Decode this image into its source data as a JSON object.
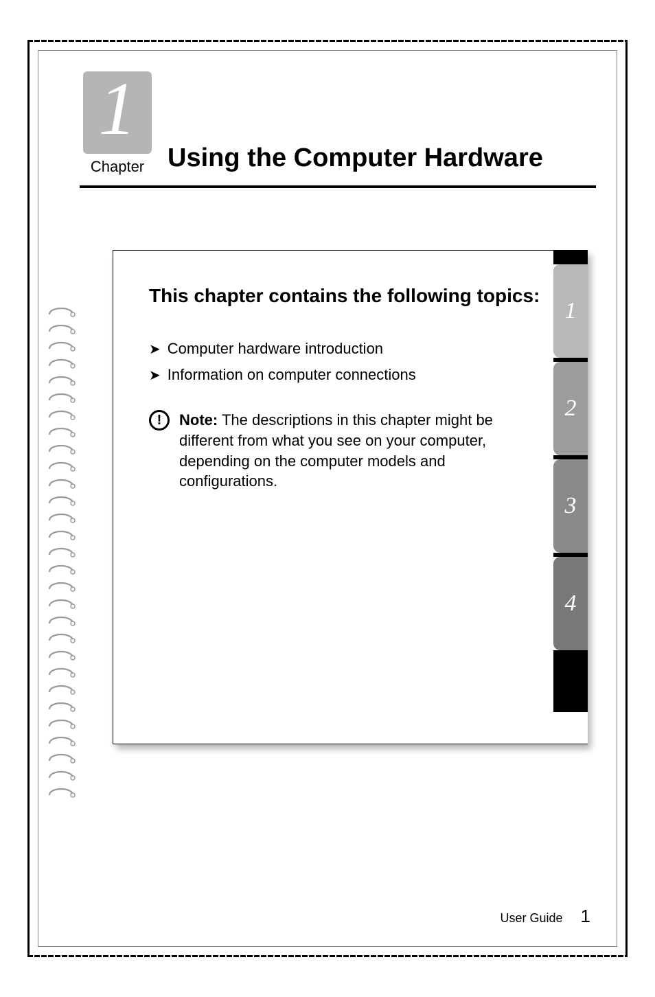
{
  "chapter": {
    "number": "1",
    "label": "Chapter",
    "title": "Using the Computer Hardware"
  },
  "topicsHeading": "This chapter contains the following topics:",
  "topics": [
    "Computer hardware introduction",
    "Information on computer connections"
  ],
  "note": {
    "label": "Note:",
    "text": "The descriptions in this chapter might be different from what you see on your computer, depending on the computer models and configurations."
  },
  "sideTabs": [
    "1",
    "2",
    "3",
    "4"
  ],
  "footer": {
    "label": "User Guide",
    "page": "1"
  }
}
